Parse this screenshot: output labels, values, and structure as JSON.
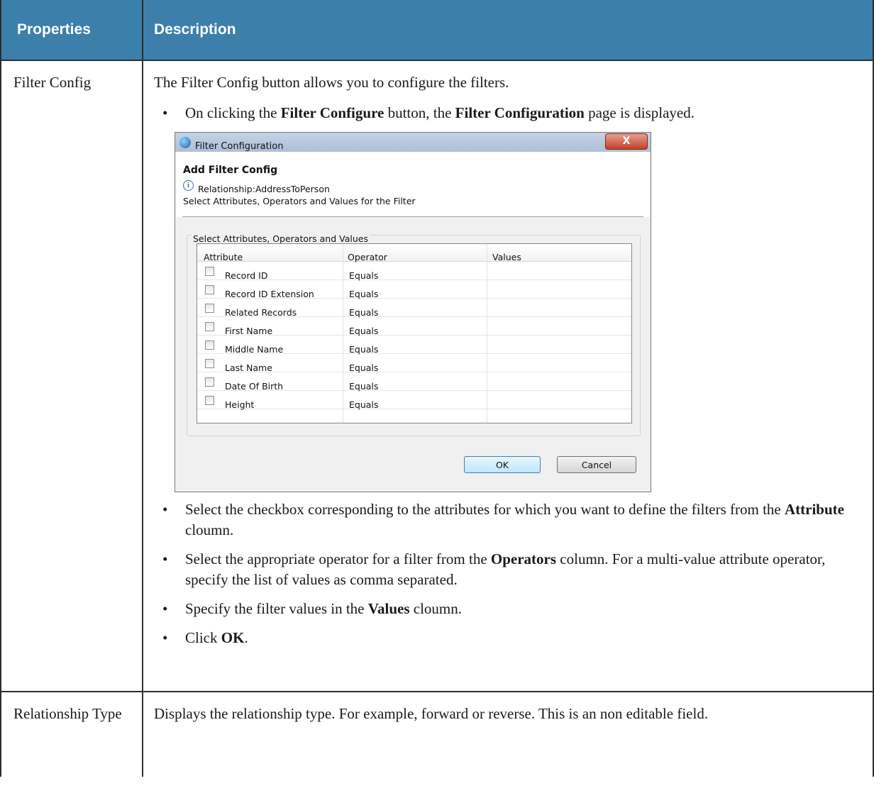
{
  "table": {
    "headers": {
      "properties": "Properties",
      "description": "Description"
    },
    "rows": [
      {
        "property": "Filter Config",
        "intro": "The Filter Config button allows you to configure the filters.",
        "bullet1": {
          "pre": "On clicking the ",
          "b1": "Filter Configure",
          "mid": " button, the ",
          "b2": "Filter Configuration",
          "post": " page is displayed."
        },
        "bullet2": {
          "pre": "Select the checkbox corresponding to the attributes for which you want to define the filters from the ",
          "b1": "Attribute",
          "post": " cloumn."
        },
        "bullet3": {
          "pre": "Select the appropriate operator for a filter from the ",
          "b1": "Operators",
          "post": " column. For a multi-value attribute operator, specify the list of values as comma separated."
        },
        "bullet4": {
          "pre": "Specify the filter values in the ",
          "b1": "Values",
          "post": " cloumn."
        },
        "bullet5": {
          "pre": "Click ",
          "b1": "OK",
          "post": "."
        }
      },
      {
        "property": "Relationship Type",
        "description": "Displays the relationship type. For example, forward or reverse. This is an non editable field."
      }
    ]
  },
  "dialog": {
    "title": "Filter Configuration",
    "close_glyph": "X",
    "header_title": "Add Filter Config",
    "info_icon": "i",
    "info_line1": "Relationship:AddressToPerson",
    "info_line2": "Select Attributes, Operators and Values for the Filter",
    "group_label": "Select Attributes, Operators and Values",
    "columns": {
      "attribute": "Attribute",
      "operator": "Operator",
      "values": "Values"
    },
    "rows": [
      {
        "attribute": "Record ID",
        "operator": "Equals"
      },
      {
        "attribute": "Record ID Extension",
        "operator": "Equals"
      },
      {
        "attribute": "Related Records",
        "operator": "Equals"
      },
      {
        "attribute": "First Name",
        "operator": "Equals"
      },
      {
        "attribute": "Middle Name",
        "operator": "Equals"
      },
      {
        "attribute": "Last Name",
        "operator": "Equals"
      },
      {
        "attribute": "Date Of Birth",
        "operator": "Equals"
      },
      {
        "attribute": "Height",
        "operator": "Equals"
      }
    ],
    "ok_label": "OK",
    "cancel_label": "Cancel"
  },
  "bullet_glyph": "•",
  "colors": {
    "header_bg": "#3c7fab",
    "header_text": "#ffffff",
    "border": "#2d2d2d"
  }
}
